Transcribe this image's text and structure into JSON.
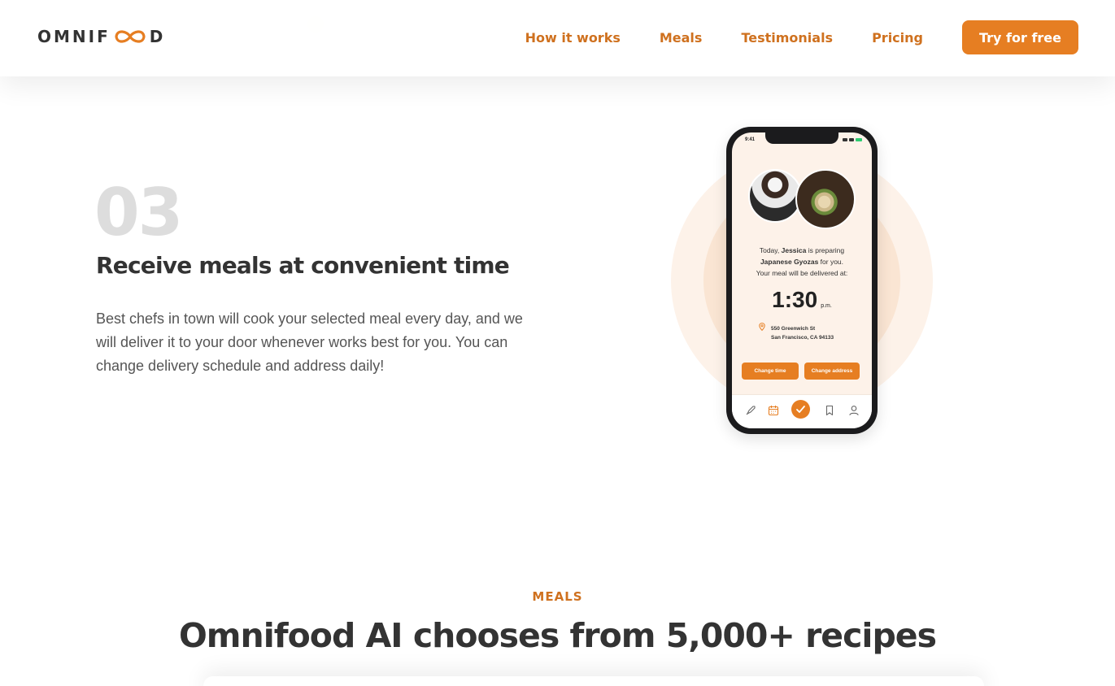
{
  "header": {
    "logo": {
      "before": "OMNIF",
      "after": "D",
      "icon": "infinity-loop-icon"
    },
    "nav": [
      {
        "label": "How it works"
      },
      {
        "label": "Meals"
      },
      {
        "label": "Testimonials"
      },
      {
        "label": "Pricing"
      }
    ],
    "cta_label": "Try for free"
  },
  "step": {
    "number": "03",
    "title": "Receive meals at convenient time",
    "description": "Best chefs in town will cook your selected meal every day, and we will deliver it to your door whenever works best for you. You can change delivery schedule and address daily!"
  },
  "phone": {
    "status_time": "9:41",
    "message": {
      "l1_pre": "Today, ",
      "chef": "Jessica",
      "l1_post": " is preparing",
      "dish": "Japanese Gyozas",
      "l2_post": " for you.",
      "l3": "Your meal will be delivered at:"
    },
    "delivery_time": "1:30",
    "delivery_period": "p.m.",
    "address_line1": "550 Greenwich St",
    "address_line2": "San Francisco, CA 94133",
    "change_time_label": "Change time",
    "change_address_label": "Change address",
    "tabs": [
      "rocket-icon",
      "calendar-icon",
      "check-icon",
      "bookmark-icon",
      "user-icon"
    ]
  },
  "meals": {
    "subheading": "MEALS",
    "heading": "Omnifood AI chooses from 5,000+ recipes"
  },
  "colors": {
    "primary": "#e67e22",
    "primary_dark": "#cf711f",
    "tint_light": "#fdf2e9",
    "tint": "#fae5d3",
    "text": "#333333",
    "step_number": "#dddddd"
  }
}
